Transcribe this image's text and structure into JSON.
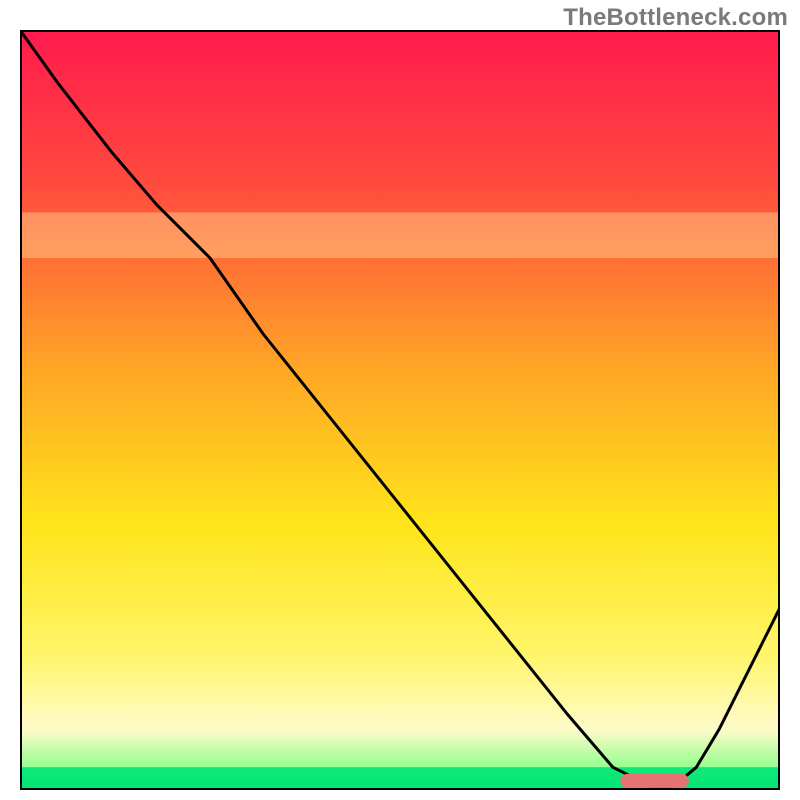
{
  "watermark": "TheBottleneck.com",
  "chart_data": {
    "type": "line",
    "title": "",
    "xlabel": "",
    "ylabel": "",
    "xlim": [
      0,
      100
    ],
    "ylim": [
      0,
      100
    ],
    "gradient_stops": [
      {
        "offset": 0.0,
        "color": "#ff1a4e"
      },
      {
        "offset": 0.2,
        "color": "#ff4a3e"
      },
      {
        "offset": 0.45,
        "color": "#ffa726"
      },
      {
        "offset": 0.65,
        "color": "#ffe41a"
      },
      {
        "offset": 0.82,
        "color": "#fff569"
      },
      {
        "offset": 0.92,
        "color": "#fffbc9"
      },
      {
        "offset": 0.975,
        "color": "#8aff8a"
      },
      {
        "offset": 1.0,
        "color": "#00d86b"
      }
    ],
    "band_regions": [
      {
        "y0": 70,
        "y1": 76,
        "color": "#fff9b0",
        "alpha": 0.35
      },
      {
        "y0": 0,
        "y1": 3,
        "color": "#00e676",
        "alpha": 0.9
      }
    ],
    "curve": {
      "x": [
        0,
        5,
        12,
        18,
        25,
        32,
        40,
        48,
        56,
        64,
        72,
        78,
        83,
        86,
        89,
        92,
        95,
        98,
        100
      ],
      "y": [
        100,
        93,
        84,
        77,
        70,
        60,
        50,
        40,
        30,
        20,
        10,
        3,
        0.5,
        0.5,
        3,
        8,
        14,
        20,
        24
      ]
    },
    "marker": {
      "x0": 79,
      "x1": 88,
      "y": 1.2,
      "color": "#e57373"
    }
  }
}
